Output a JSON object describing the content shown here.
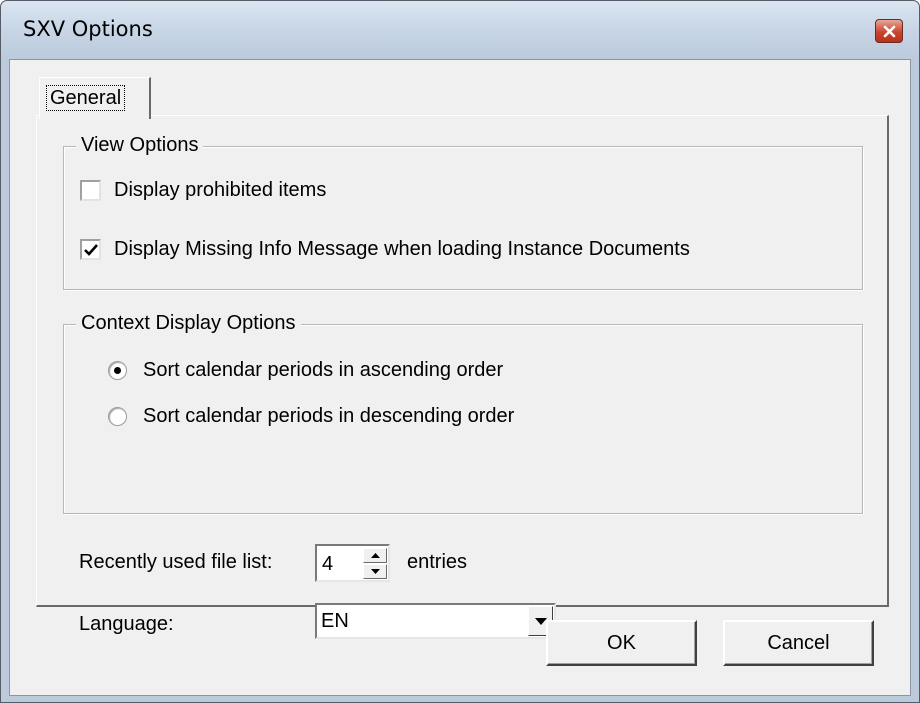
{
  "window": {
    "title": "SXV Options"
  },
  "tabs": [
    {
      "label": "General",
      "selected": true
    }
  ],
  "view_options": {
    "title": "View Options",
    "items": [
      {
        "label": "Display prohibited items",
        "checked": false
      },
      {
        "label": "Display Missing Info Message when loading Instance Documents",
        "checked": true
      }
    ]
  },
  "context_display_options": {
    "title": "Context Display Options",
    "items": [
      {
        "label": "Sort calendar periods in ascending order",
        "selected": true
      },
      {
        "label": "Sort calendar periods in descending order",
        "selected": false
      }
    ]
  },
  "recent_files": {
    "label": "Recently used file list:",
    "value": "4",
    "suffix": "entries"
  },
  "language": {
    "label": "Language:",
    "value": "EN"
  },
  "buttons": {
    "ok": "OK",
    "cancel": "Cancel"
  }
}
